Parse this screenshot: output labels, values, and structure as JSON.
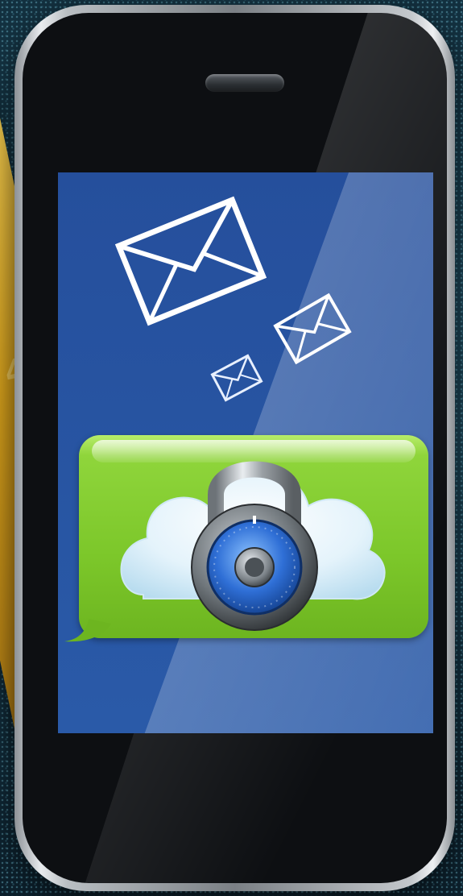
{
  "scene": {
    "subject": "smartphone",
    "screen_icons": [
      "envelope-icon",
      "envelope-icon",
      "envelope-icon",
      "message-bubble-icon",
      "cloud-icon",
      "padlock-icon"
    ]
  },
  "colors": {
    "screen_blue": "#2a5aa8",
    "bubble_green": "#7cc72a",
    "lock_dial_blue": "#2f6fd6",
    "card_gold": "#d8a21c"
  }
}
